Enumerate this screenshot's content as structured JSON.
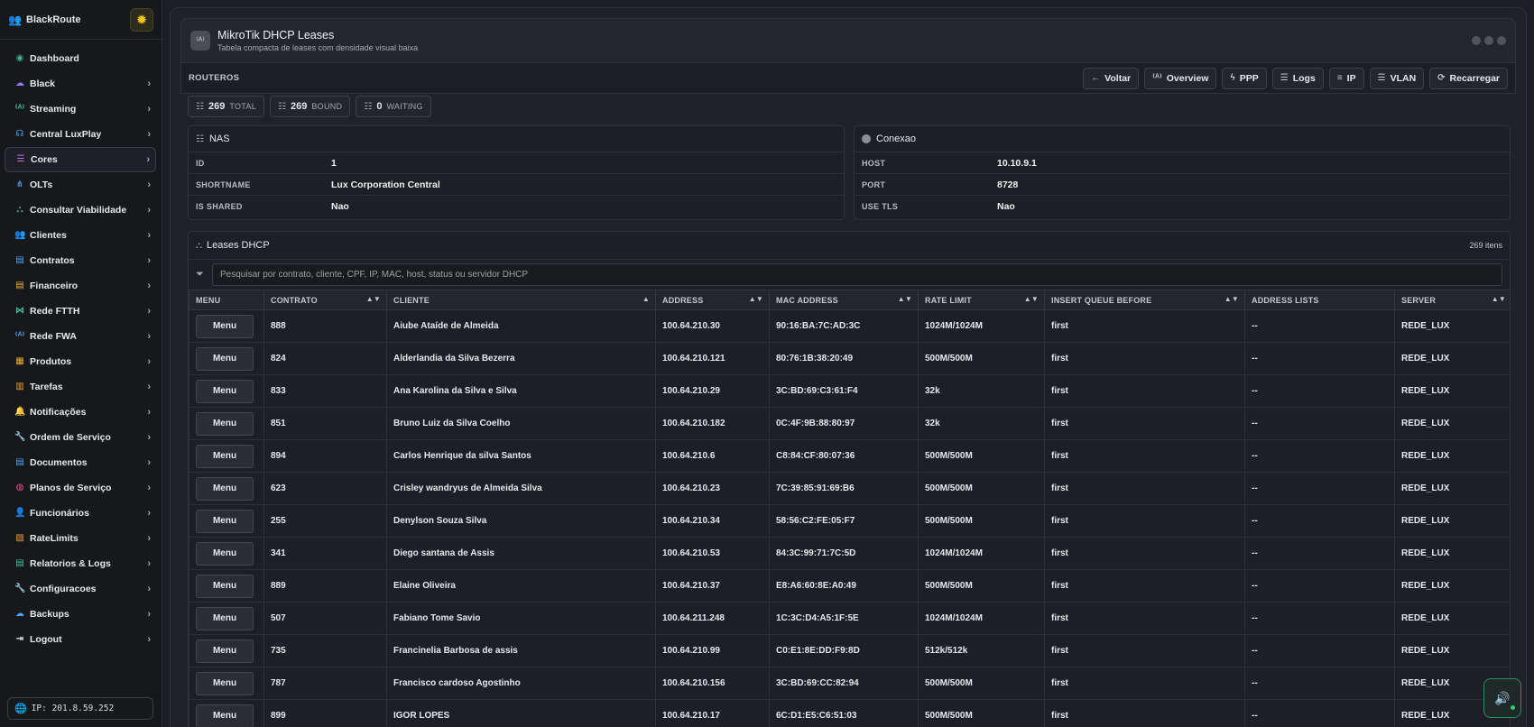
{
  "app": {
    "brand": "BlackRoute",
    "ip_label": "IP: 201.8.59.252"
  },
  "sidebar": {
    "items": [
      {
        "label": "Dashboard",
        "icon": "dashboard-icon",
        "color": "#3bb08f",
        "chevron": false
      },
      {
        "label": "Black",
        "icon": "cloud-icon",
        "color": "#8e7cf0",
        "chevron": true
      },
      {
        "label": "Streaming",
        "icon": "broadcast-icon",
        "color": "#3bc6a0",
        "chevron": true
      },
      {
        "label": "Central LuxPlay",
        "icon": "headset-icon",
        "color": "#4aa8f0",
        "chevron": true
      },
      {
        "label": "Cores",
        "icon": "palette-icon",
        "color": "#c56cf0",
        "chevron": true,
        "active": true
      },
      {
        "label": "OLTs",
        "icon": "network-icon",
        "color": "#4a90e2",
        "chevron": true
      },
      {
        "label": "Consultar Viabilidade",
        "icon": "sitemap-icon",
        "color": "#3bb08f",
        "chevron": true
      },
      {
        "label": "Clientes",
        "icon": "users-icon",
        "color": "#3bb08f",
        "chevron": true
      },
      {
        "label": "Contratos",
        "icon": "file-icon",
        "color": "#4aa8f0",
        "chevron": true
      },
      {
        "label": "Financeiro",
        "icon": "invoice-icon",
        "color": "#f0b030",
        "chevron": true
      },
      {
        "label": "Rede FTTH",
        "icon": "fiber-icon",
        "color": "#3bc6a0",
        "chevron": true
      },
      {
        "label": "Rede FWA",
        "icon": "antenna-icon",
        "color": "#4aa8f0",
        "chevron": true
      },
      {
        "label": "Produtos",
        "icon": "box-icon",
        "color": "#f0b030",
        "chevron": true
      },
      {
        "label": "Tarefas",
        "icon": "tasks-icon",
        "color": "#f0a030",
        "chevron": true
      },
      {
        "label": "Notificações",
        "icon": "bell-icon",
        "color": "#f05050",
        "chevron": true
      },
      {
        "label": "Ordem de Serviço",
        "icon": "wrench-icon",
        "color": "#3bb08f",
        "chevron": true
      },
      {
        "label": "Documentos",
        "icon": "document-icon",
        "color": "#4aa8f0",
        "chevron": true
      },
      {
        "label": "Planos de Serviço",
        "icon": "plans-icon",
        "color": "#f05090",
        "chevron": true
      },
      {
        "label": "Funcionários",
        "icon": "employee-icon",
        "color": "#3bb08f",
        "chevron": true
      },
      {
        "label": "RateLimits",
        "icon": "gauge-icon",
        "color": "#f0a030",
        "chevron": true
      },
      {
        "label": "Relatorios & Logs",
        "icon": "report-icon",
        "color": "#3bc6a0",
        "chevron": true
      },
      {
        "label": "Configuracoes",
        "icon": "tools-icon",
        "color": "#8e7cf0",
        "chevron": true
      },
      {
        "label": "Backups",
        "icon": "cloud-backup-icon",
        "color": "#4aa8f0",
        "chevron": true
      },
      {
        "label": "Logout",
        "icon": "logout-icon",
        "color": "#e6e8ec",
        "chevron": true
      }
    ]
  },
  "header": {
    "title": "MikroTik DHCP Leases",
    "subtitle": "Tabela compacta de leases com densidade visual baixa"
  },
  "toolbar": {
    "label": "ROUTEROS",
    "buttons": [
      {
        "label": "Voltar",
        "icon": "arrow-left-icon",
        "glyph": "←"
      },
      {
        "label": "Overview",
        "icon": "broadcast-icon",
        "glyph": "⁽ᴬ⁾"
      },
      {
        "label": "PPP",
        "icon": "bolt-icon",
        "glyph": "ϟ"
      },
      {
        "label": "Logs",
        "icon": "list-icon",
        "glyph": "☰"
      },
      {
        "label": "IP",
        "icon": "sliders-icon",
        "glyph": "≡"
      },
      {
        "label": "VLAN",
        "icon": "layers-icon",
        "glyph": "☰"
      },
      {
        "label": "Recarregar",
        "icon": "refresh-icon",
        "glyph": "⟳"
      }
    ]
  },
  "counters": [
    {
      "value": "269",
      "label": "TOTAL"
    },
    {
      "value": "269",
      "label": "BOUND"
    },
    {
      "value": "0",
      "label": "WAITING"
    }
  ],
  "nas": {
    "title": "NAS",
    "rows": [
      {
        "key": "ID",
        "value": "1"
      },
      {
        "key": "SHORTNAME",
        "value": "Lux Corporation Central"
      },
      {
        "key": "IS SHARED",
        "value": "Nao"
      }
    ]
  },
  "conexao": {
    "title": "Conexao",
    "rows": [
      {
        "key": "HOST",
        "value": "10.10.9.1"
      },
      {
        "key": "PORT",
        "value": "8728"
      },
      {
        "key": "USE TLS",
        "value": "Nao"
      }
    ]
  },
  "leases": {
    "title": "Leases DHCP",
    "count": "269 itens",
    "search_placeholder": "Pesquisar por contrato, cliente, CPF, IP, MAC, host, status ou servidor DHCP",
    "menu_label": "Menu",
    "columns": [
      {
        "label": "MENU",
        "sort": ""
      },
      {
        "label": "CONTRATO",
        "sort": "▲▼"
      },
      {
        "label": "CLIENTE",
        "sort": "▲"
      },
      {
        "label": "ADDRESS",
        "sort": "▲▼"
      },
      {
        "label": "MAC ADDRESS",
        "sort": "▲▼"
      },
      {
        "label": "RATE LIMIT",
        "sort": "▲▼"
      },
      {
        "label": "INSERT QUEUE BEFORE",
        "sort": "▲▼"
      },
      {
        "label": "ADDRESS LISTS",
        "sort": ""
      },
      {
        "label": "SERVER",
        "sort": "▲▼"
      }
    ],
    "rows": [
      [
        "888",
        "Aiube Ataíde de Almeida",
        "100.64.210.30",
        "90:16:BA:7C:AD:3C",
        "1024M/1024M",
        "first",
        "--",
        "REDE_LUX"
      ],
      [
        "824",
        "Alderlandia da Silva Bezerra",
        "100.64.210.121",
        "80:76:1B:38:20:49",
        "500M/500M",
        "first",
        "--",
        "REDE_LUX"
      ],
      [
        "833",
        "Ana Karolina da Silva e Silva",
        "100.64.210.29",
        "3C:BD:69:C3:61:F4",
        "32k",
        "first",
        "--",
        "REDE_LUX"
      ],
      [
        "851",
        "Bruno Luiz da Silva Coelho",
        "100.64.210.182",
        "0C:4F:9B:88:80:97",
        "32k",
        "first",
        "--",
        "REDE_LUX"
      ],
      [
        "894",
        "Carlos Henrique da silva Santos",
        "100.64.210.6",
        "C8:84:CF:80:07:36",
        "500M/500M",
        "first",
        "--",
        "REDE_LUX"
      ],
      [
        "623",
        "Crisley wandryus de Almeida Silva",
        "100.64.210.23",
        "7C:39:85:91:69:B6",
        "500M/500M",
        "first",
        "--",
        "REDE_LUX"
      ],
      [
        "255",
        "Denylson Souza Silva",
        "100.64.210.34",
        "58:56:C2:FE:05:F7",
        "500M/500M",
        "first",
        "--",
        "REDE_LUX"
      ],
      [
        "341",
        "Diego santana de Assis",
        "100.64.210.53",
        "84:3C:99:71:7C:5D",
        "1024M/1024M",
        "first",
        "--",
        "REDE_LUX"
      ],
      [
        "889",
        "Elaine Oliveira",
        "100.64.210.37",
        "E8:A6:60:8E:A0:49",
        "500M/500M",
        "first",
        "--",
        "REDE_LUX"
      ],
      [
        "507",
        "Fabiano Tome Savio",
        "100.64.211.248",
        "1C:3C:D4:A5:1F:5E",
        "1024M/1024M",
        "first",
        "--",
        "REDE_LUX"
      ],
      [
        "735",
        "Francinelia Barbosa de assis",
        "100.64.210.99",
        "C0:E1:8E:DD:F9:8D",
        "512k/512k",
        "first",
        "--",
        "REDE_LUX"
      ],
      [
        "787",
        "Francisco cardoso Agostinho",
        "100.64.210.156",
        "3C:BD:69:CC:82:94",
        "500M/500M",
        "first",
        "--",
        "REDE_LUX"
      ],
      [
        "899",
        "IGOR LOPES",
        "100.64.210.17",
        "6C:D1:E5:C6:51:03",
        "500M/500M",
        "first",
        "--",
        "REDE_LUX"
      ]
    ]
  }
}
